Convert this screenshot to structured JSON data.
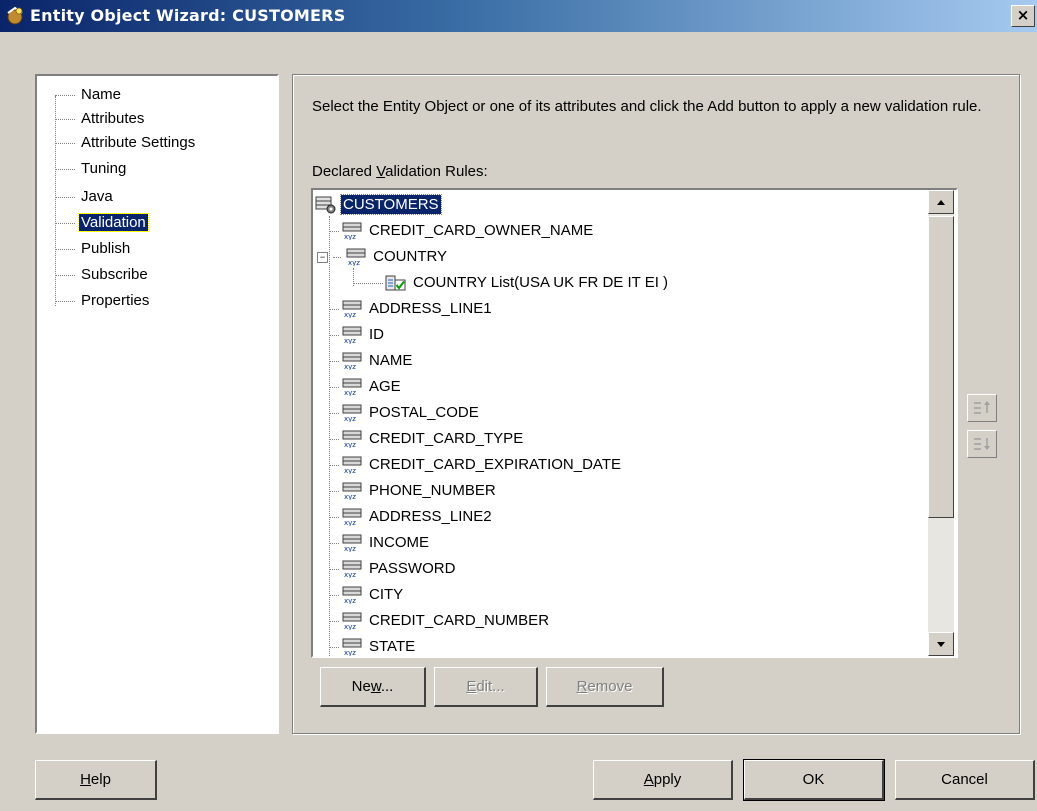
{
  "window": {
    "title": "Entity Object Wizard: CUSTOMERS",
    "close_label": "×"
  },
  "nav": {
    "items": [
      {
        "label": "Name"
      },
      {
        "label": "Attributes"
      },
      {
        "label": "Attribute Settings"
      },
      {
        "label": "Tuning"
      },
      {
        "label": "Java"
      },
      {
        "label": "Validation",
        "selected": true
      },
      {
        "label": "Publish"
      },
      {
        "label": "Subscribe"
      },
      {
        "label": "Properties"
      }
    ]
  },
  "main": {
    "instructions": "Select the Entity Object or one of its attributes and click the Add button to apply a new validation rule.",
    "declared_label_pre": "Declared ",
    "declared_label_mnemonic": "V",
    "declared_label_post": "alidation Rules:",
    "tree": {
      "root": "CUSTOMERS",
      "attributes": [
        "CREDIT_CARD_OWNER_NAME",
        "COUNTRY",
        "COUNTRY List(USA UK FR DE IT EI )",
        "ADDRESS_LINE1",
        "ID",
        "NAME",
        "AGE",
        "POSTAL_CODE",
        "CREDIT_CARD_TYPE",
        "CREDIT_CARD_EXPIRATION_DATE",
        "PHONE_NUMBER",
        "ADDRESS_LINE2",
        "INCOME",
        "PASSWORD",
        "CITY",
        "CREDIT_CARD_NUMBER",
        "STATE"
      ]
    },
    "buttons": {
      "new_pre": "Ne",
      "new_mn": "w",
      "new_post": "...",
      "edit_pre": "",
      "edit_mn": "E",
      "edit_post": "dit...",
      "remove_pre": "",
      "remove_mn": "R",
      "remove_post": "emove"
    }
  },
  "footer": {
    "help_mn": "H",
    "help_post": "elp",
    "apply_mn": "A",
    "apply_post": "pply",
    "ok": "OK",
    "cancel": "Cancel"
  },
  "colors": {
    "selection": "#0a246a",
    "face": "#d4d0c8"
  }
}
